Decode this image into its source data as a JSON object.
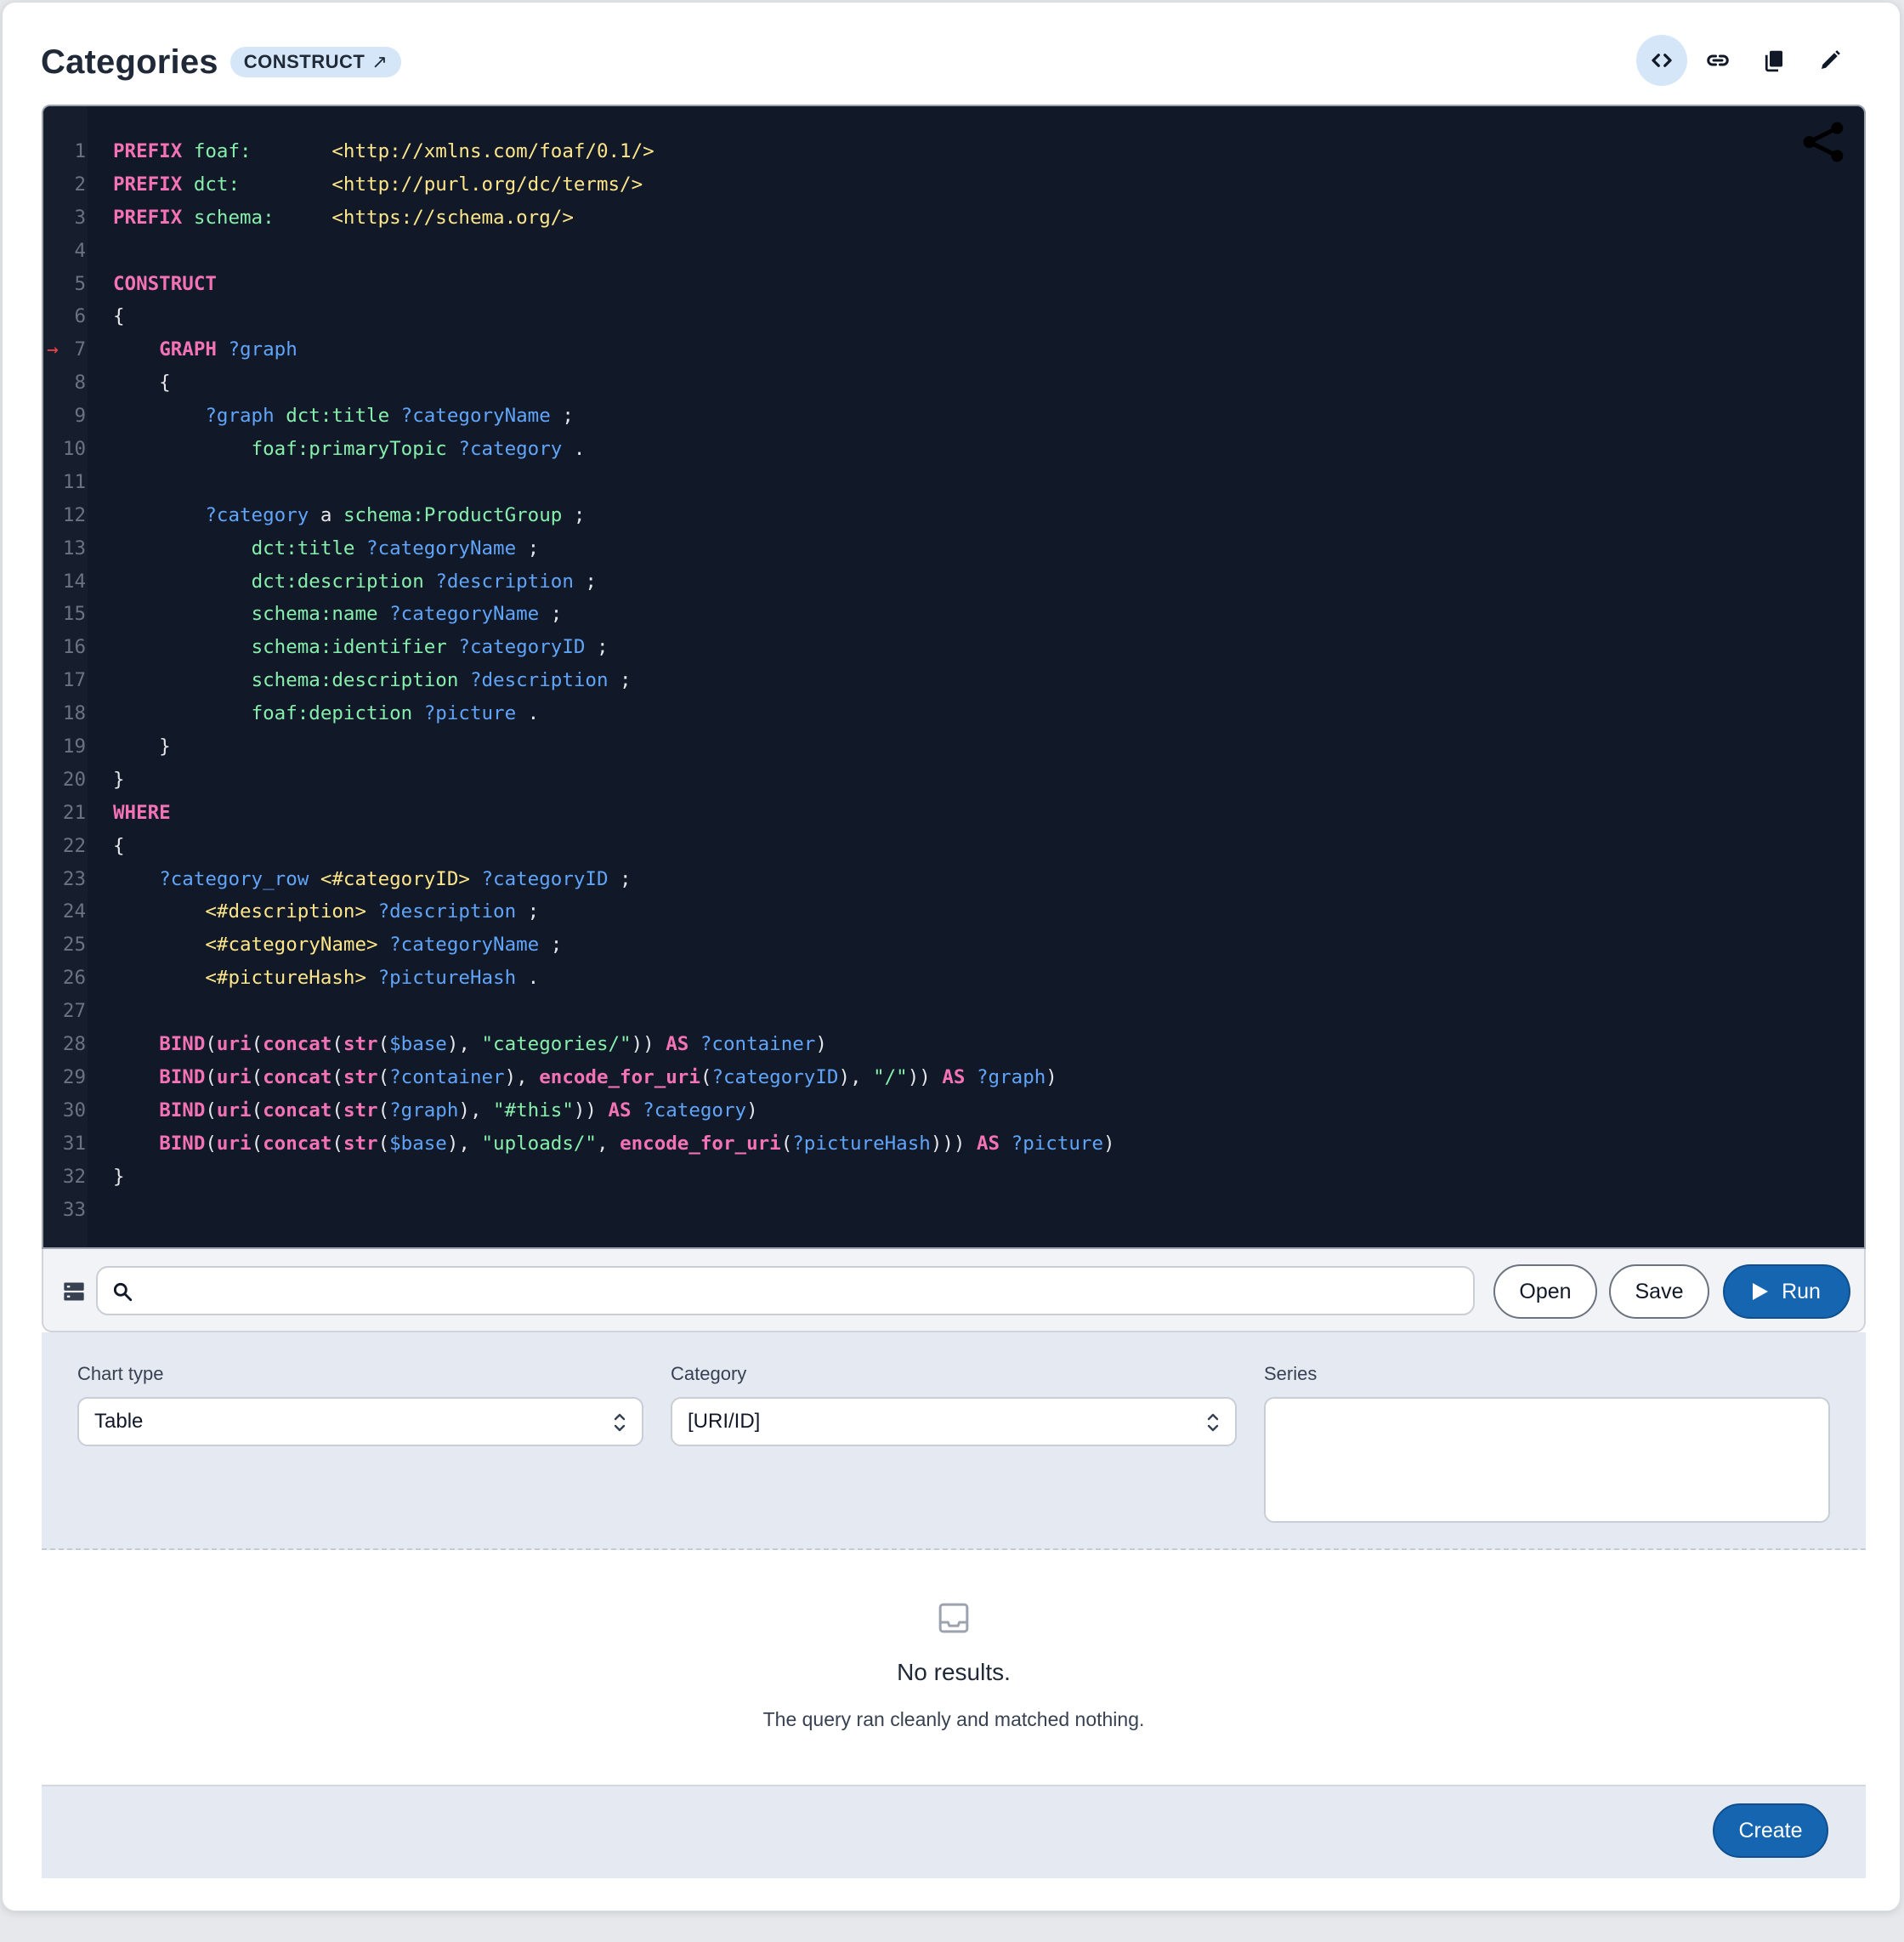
{
  "header": {
    "title": "Categories",
    "badge": "CONSTRUCT",
    "badge_icon": "external-arrow"
  },
  "toolbar": {
    "icons": [
      "code-icon",
      "link-icon",
      "copy-icon",
      "edit-icon"
    ]
  },
  "editor": {
    "language": "SPARQL",
    "marked_line": 7,
    "lines": [
      [
        [
          "kw",
          "PREFIX"
        ],
        [
          "punc",
          " "
        ],
        [
          "pre",
          "foaf:"
        ],
        [
          "punc",
          "       "
        ],
        [
          "iri",
          "<http://xmlns.com/foaf/0.1/>"
        ]
      ],
      [
        [
          "kw",
          "PREFIX"
        ],
        [
          "punc",
          " "
        ],
        [
          "pre",
          "dct:"
        ],
        [
          "punc",
          "        "
        ],
        [
          "iri",
          "<http://purl.org/dc/terms/>"
        ]
      ],
      [
        [
          "kw",
          "PREFIX"
        ],
        [
          "punc",
          " "
        ],
        [
          "pre",
          "schema:"
        ],
        [
          "punc",
          "     "
        ],
        [
          "iri",
          "<https://schema.org/>"
        ]
      ],
      [],
      [
        [
          "kw",
          "CONSTRUCT"
        ]
      ],
      [
        [
          "punc",
          "{"
        ]
      ],
      [
        [
          "punc",
          "    "
        ],
        [
          "kw",
          "GRAPH"
        ],
        [
          "punc",
          " "
        ],
        [
          "var",
          "?graph"
        ]
      ],
      [
        [
          "punc",
          "    {"
        ]
      ],
      [
        [
          "punc",
          "        "
        ],
        [
          "var",
          "?graph"
        ],
        [
          "punc",
          " "
        ],
        [
          "pre",
          "dct:title"
        ],
        [
          "punc",
          " "
        ],
        [
          "var",
          "?categoryName"
        ],
        [
          "punc",
          " ;"
        ]
      ],
      [
        [
          "punc",
          "            "
        ],
        [
          "pre",
          "foaf:primaryTopic"
        ],
        [
          "punc",
          " "
        ],
        [
          "var",
          "?category"
        ],
        [
          "punc",
          " ."
        ]
      ],
      [],
      [
        [
          "punc",
          "        "
        ],
        [
          "var",
          "?category"
        ],
        [
          "punc",
          " a "
        ],
        [
          "pre",
          "schema:ProductGroup"
        ],
        [
          "punc",
          " ;"
        ]
      ],
      [
        [
          "punc",
          "            "
        ],
        [
          "pre",
          "dct:title"
        ],
        [
          "punc",
          " "
        ],
        [
          "var",
          "?categoryName"
        ],
        [
          "punc",
          " ;"
        ]
      ],
      [
        [
          "punc",
          "            "
        ],
        [
          "pre",
          "dct:description"
        ],
        [
          "punc",
          " "
        ],
        [
          "var",
          "?description"
        ],
        [
          "punc",
          " ;"
        ]
      ],
      [
        [
          "punc",
          "            "
        ],
        [
          "pre",
          "schema:name"
        ],
        [
          "punc",
          " "
        ],
        [
          "var",
          "?categoryName"
        ],
        [
          "punc",
          " ;"
        ]
      ],
      [
        [
          "punc",
          "            "
        ],
        [
          "pre",
          "schema:identifier"
        ],
        [
          "punc",
          " "
        ],
        [
          "var",
          "?categoryID"
        ],
        [
          "punc",
          " ;"
        ]
      ],
      [
        [
          "punc",
          "            "
        ],
        [
          "pre",
          "schema:description"
        ],
        [
          "punc",
          " "
        ],
        [
          "var",
          "?description"
        ],
        [
          "punc",
          " ;"
        ]
      ],
      [
        [
          "punc",
          "            "
        ],
        [
          "pre",
          "foaf:depiction"
        ],
        [
          "punc",
          " "
        ],
        [
          "var",
          "?picture"
        ],
        [
          "punc",
          " ."
        ]
      ],
      [
        [
          "punc",
          "    }"
        ]
      ],
      [
        [
          "punc",
          "}"
        ]
      ],
      [
        [
          "kw",
          "WHERE"
        ]
      ],
      [
        [
          "punc",
          "{"
        ]
      ],
      [
        [
          "punc",
          "    "
        ],
        [
          "var",
          "?category_row"
        ],
        [
          "punc",
          " "
        ],
        [
          "iri",
          "<#categoryID>"
        ],
        [
          "punc",
          " "
        ],
        [
          "var",
          "?categoryID"
        ],
        [
          "punc",
          " ;"
        ]
      ],
      [
        [
          "punc",
          "        "
        ],
        [
          "iri",
          "<#description>"
        ],
        [
          "punc",
          " "
        ],
        [
          "var",
          "?description"
        ],
        [
          "punc",
          " ;"
        ]
      ],
      [
        [
          "punc",
          "        "
        ],
        [
          "iri",
          "<#categoryName>"
        ],
        [
          "punc",
          " "
        ],
        [
          "var",
          "?categoryName"
        ],
        [
          "punc",
          " ;"
        ]
      ],
      [
        [
          "punc",
          "        "
        ],
        [
          "iri",
          "<#pictureHash>"
        ],
        [
          "punc",
          " "
        ],
        [
          "var",
          "?pictureHash"
        ],
        [
          "punc",
          " ."
        ]
      ],
      [],
      [
        [
          "punc",
          "    "
        ],
        [
          "fn",
          "BIND"
        ],
        [
          "punc",
          "("
        ],
        [
          "fn",
          "uri"
        ],
        [
          "punc",
          "("
        ],
        [
          "fn",
          "concat"
        ],
        [
          "punc",
          "("
        ],
        [
          "fn",
          "str"
        ],
        [
          "punc",
          "("
        ],
        [
          "var",
          "$base"
        ],
        [
          "punc",
          "), "
        ],
        [
          "str",
          "\"categories/\""
        ],
        [
          "punc",
          "))"
        ],
        [
          "punc",
          " "
        ],
        [
          "kw",
          "AS"
        ],
        [
          "punc",
          " "
        ],
        [
          "var",
          "?container"
        ],
        [
          "punc",
          ")"
        ]
      ],
      [
        [
          "punc",
          "    "
        ],
        [
          "fn",
          "BIND"
        ],
        [
          "punc",
          "("
        ],
        [
          "fn",
          "uri"
        ],
        [
          "punc",
          "("
        ],
        [
          "fn",
          "concat"
        ],
        [
          "punc",
          "("
        ],
        [
          "fn",
          "str"
        ],
        [
          "punc",
          "("
        ],
        [
          "var",
          "?container"
        ],
        [
          "punc",
          "), "
        ],
        [
          "fn",
          "encode_for_uri"
        ],
        [
          "punc",
          "("
        ],
        [
          "var",
          "?categoryID"
        ],
        [
          "punc",
          "), "
        ],
        [
          "str",
          "\"/\""
        ],
        [
          "punc",
          "))"
        ],
        [
          "punc",
          " "
        ],
        [
          "kw",
          "AS"
        ],
        [
          "punc",
          " "
        ],
        [
          "var",
          "?graph"
        ],
        [
          "punc",
          ")"
        ]
      ],
      [
        [
          "punc",
          "    "
        ],
        [
          "fn",
          "BIND"
        ],
        [
          "punc",
          "("
        ],
        [
          "fn",
          "uri"
        ],
        [
          "punc",
          "("
        ],
        [
          "fn",
          "concat"
        ],
        [
          "punc",
          "("
        ],
        [
          "fn",
          "str"
        ],
        [
          "punc",
          "("
        ],
        [
          "var",
          "?graph"
        ],
        [
          "punc",
          "), "
        ],
        [
          "str",
          "\"#this\""
        ],
        [
          "punc",
          "))"
        ],
        [
          "punc",
          " "
        ],
        [
          "kw",
          "AS"
        ],
        [
          "punc",
          " "
        ],
        [
          "var",
          "?category"
        ],
        [
          "punc",
          ")"
        ]
      ],
      [
        [
          "punc",
          "    "
        ],
        [
          "fn",
          "BIND"
        ],
        [
          "punc",
          "("
        ],
        [
          "fn",
          "uri"
        ],
        [
          "punc",
          "("
        ],
        [
          "fn",
          "concat"
        ],
        [
          "punc",
          "("
        ],
        [
          "fn",
          "str"
        ],
        [
          "punc",
          "("
        ],
        [
          "var",
          "$base"
        ],
        [
          "punc",
          "), "
        ],
        [
          "str",
          "\"uploads/\""
        ],
        [
          "punc",
          ", "
        ],
        [
          "fn",
          "encode_for_uri"
        ],
        [
          "punc",
          "("
        ],
        [
          "var",
          "?pictureHash"
        ],
        [
          "punc",
          ")))"
        ],
        [
          "punc",
          " "
        ],
        [
          "kw",
          "AS"
        ],
        [
          "punc",
          " "
        ],
        [
          "var",
          "?picture"
        ],
        [
          "punc",
          ")"
        ]
      ],
      [
        [
          "punc",
          "}"
        ]
      ],
      []
    ]
  },
  "search": {
    "value": "",
    "placeholder": ""
  },
  "buttons": {
    "open": "Open",
    "save": "Save",
    "run": "Run",
    "create": "Create"
  },
  "chart_settings": {
    "chart_type_label": "Chart type",
    "chart_type_value": "Table",
    "category_label": "Category",
    "category_value": "[URI/ID]",
    "series_label": "Series"
  },
  "results": {
    "title": "No results.",
    "subtitle": "The query ran cleanly and matched nothing."
  },
  "colors": {
    "editor_bg": "#111827",
    "keyword": "#f472b6",
    "prefix": "#86efac",
    "iri": "#fde68a",
    "variable": "#60a5fa",
    "primary": "#1565b0",
    "badge_bg": "#d5e6f8"
  }
}
